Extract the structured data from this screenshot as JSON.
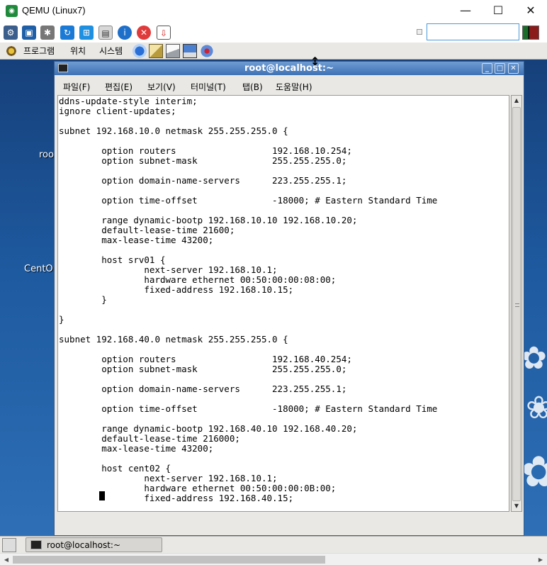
{
  "window": {
    "title": "QEMU (Linux7)",
    "minimize_glyph": "—",
    "maximize_glyph": "☐",
    "close_glyph": "✕"
  },
  "toolbar": {
    "icons": [
      "qemu-settings-icon",
      "fullscreen-icon",
      "gear-icon",
      "refresh-icon",
      "windows-icon",
      "shell-icon",
      "info-icon",
      "stop-icon",
      "screenshot-icon"
    ],
    "search": {
      "value": "",
      "placeholder": ""
    }
  },
  "gnome_panel": {
    "menus": [
      "프로그램",
      "위치",
      "시스템"
    ],
    "launchers": [
      "browser-icon",
      "mail-icon",
      "documents-icon",
      "screenshot-tool-icon",
      "network-icon"
    ]
  },
  "desktop": {
    "icon_labels": [
      "roo",
      "CentO"
    ]
  },
  "terminal": {
    "title": "root@localhost:~",
    "menu": [
      "파일(F)",
      "편집(E)",
      "보기(V)",
      "터미널(T)",
      "탭(B)",
      "도움말(H)"
    ],
    "content": "ddns-update-style interim;\nignore client-updates;\n\nsubnet 192.168.10.0 netmask 255.255.255.0 {\n\n        option routers                  192.168.10.254;\n        option subnet-mask              255.255.255.0;\n\n        option domain-name-servers      223.255.255.1;\n\n        option time-offset              -18000; # Eastern Standard Time\n\n        range dynamic-bootp 192.168.10.10 192.168.10.20;\n        default-lease-time 21600;\n        max-lease-time 43200;\n\n        host srv01 {\n                next-server 192.168.10.1;\n                hardware ethernet 00:50:00:00:08:00;\n                fixed-address 192.168.10.15;\n        }\n\n}\n\nsubnet 192.168.40.0 netmask 255.255.255.0 {\n\n        option routers                  192.168.40.254;\n        option subnet-mask              255.255.255.0;\n\n        option domain-name-servers      223.255.255.1;\n\n        option time-offset              -18000; # Eastern Standard Time\n\n        range dynamic-bootp 192.168.40.10 192.168.40.20;\n        default-lease-time 216000;\n        max-lease-time 43200;\n\n        host cent02 {\n                next-server 192.168.10.1;\n                hardware ethernet 00:50:00:00:0B:00;\n                fixed-address 192.168.40.15;"
  },
  "taskbar": {
    "task_label": "root@localhost:~"
  },
  "colors": {
    "titlebar_blue": "#3e72b6",
    "desktop_blue": "#1f4a86",
    "panel_gray": "#e9e8e5"
  }
}
